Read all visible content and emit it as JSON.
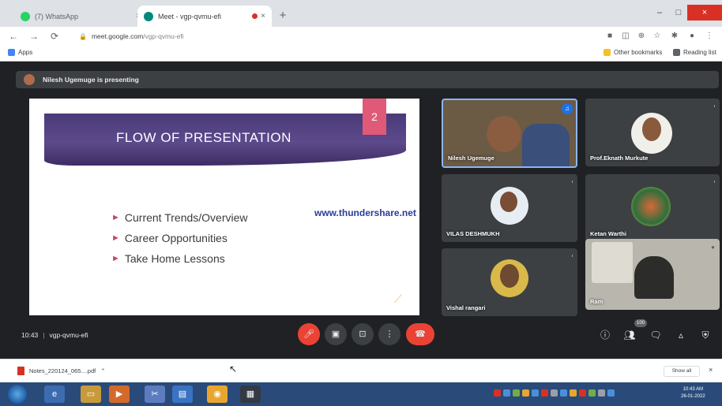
{
  "browser": {
    "tabs": [
      {
        "label": "(7) WhatsApp",
        "active": false
      },
      {
        "label": "Meet - vgp-qvmu-efi",
        "active": true
      }
    ],
    "url": {
      "host": "meet.google.com",
      "path": "/vgp-qvmu-efi"
    },
    "bookmarks": {
      "apps": "Apps",
      "other": "Other bookmarks",
      "reading_list": "Reading list"
    },
    "icons": {
      "back": "←",
      "forward": "→",
      "reload": "⟳",
      "star": "☆",
      "lock": "🔒",
      "new_tab": "+",
      "close": "×",
      "minimize": "–",
      "maximize": "□"
    }
  },
  "meet": {
    "presenting_banner": "Nilesh Ugemuge is presenting",
    "slide": {
      "number": "2",
      "title": "FLOW OF PRESENTATION",
      "bullets": [
        "Current Trends/Overview",
        "Career Opportunities",
        "Take Home Lessons"
      ],
      "watermark": "www.thundershare.net"
    },
    "participants": [
      {
        "name": "Nilesh Ugemuge",
        "speaking": true
      },
      {
        "name": "Prof.Eknath Murkute"
      },
      {
        "name": "VILAS DESHMUKH"
      },
      {
        "name": "Ketan Warthi"
      },
      {
        "name": "Vishal rangari"
      },
      {
        "name": "Ram"
      }
    ],
    "time": "10:43",
    "meeting_code": "vgp-qvmu-efi",
    "participant_count": "100"
  },
  "downloads": {
    "file": "Notes_220124_065....pdf",
    "show_all": "Show all"
  },
  "taskbar": {
    "clock_time": "10:43 AM",
    "clock_date": "26-01-2022"
  },
  "colors": {
    "meet_bg": "#202124",
    "tile_bg": "#3c4043",
    "mic_off_red": "#ea4335",
    "slide_banner": "#4b3a78",
    "slide_accent": "#e05a77"
  }
}
